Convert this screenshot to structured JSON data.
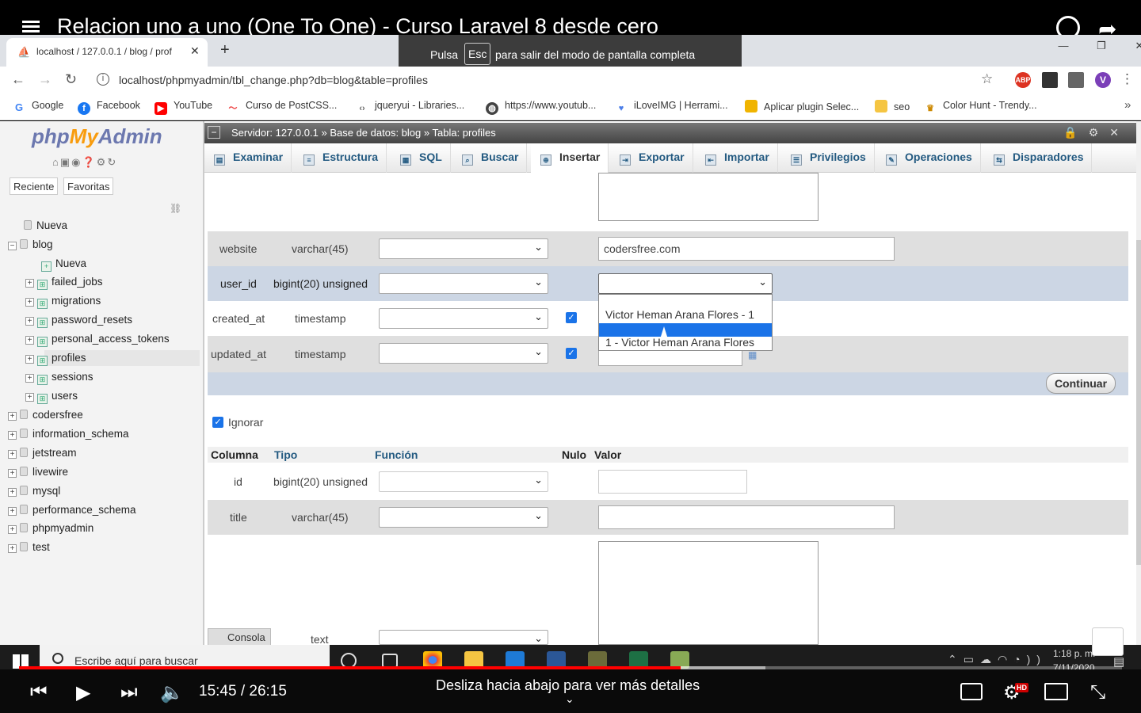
{
  "youtube": {
    "title": "Relacion uno a uno (One To One) - Curso Laravel 8 desde cero",
    "fullscreen_pre": "Pulsa",
    "fullscreen_key": "Esc",
    "fullscreen_post": "para salir del modo de pantalla completa",
    "time": "15:45 / 26:15",
    "swipe_hint": "Desliza hacia abajo para ver más detalles",
    "progress_fraction": 0.6,
    "buffer_fraction": 0.677,
    "hd_badge": "HD"
  },
  "browser": {
    "tab_title": "localhost / 127.0.0.1 / blog / prof",
    "url": "localhost/phpmyadmin/tbl_change.php?db=blog&table=profiles",
    "bookmarks": [
      "Google",
      "Facebook",
      "YouTube",
      "Curso de PostCSS...",
      "jqueryui - Libraries...",
      "https://www.youtub...",
      "iLoveIMG | Herrami...",
      "Aplicar plugin Selec...",
      "seo",
      "Color Hunt - Trendy..."
    ],
    "profile_initial": "V",
    "abp_label": "ABP"
  },
  "pma": {
    "logo_php": "php",
    "logo_my": "My",
    "logo_admin": "Admin",
    "recent": "Reciente",
    "favorites": "Favoritas",
    "tree": {
      "new": "Nueva",
      "blog": "blog",
      "blog_new": "Nueva",
      "tables": [
        "failed_jobs",
        "migrations",
        "password_resets",
        "personal_access_tokens",
        "profiles",
        "sessions",
        "users"
      ],
      "databases": [
        "codersfree",
        "information_schema",
        "jetstream",
        "livewire",
        "mysql",
        "performance_schema",
        "phpmyadmin",
        "test"
      ]
    },
    "breadcrumb": {
      "server": "Servidor: 127.0.0.1 »",
      "db": "Base de datos: blog »",
      "table": "Tabla: profiles"
    },
    "tabs": [
      "Examinar",
      "Estructura",
      "SQL",
      "Buscar",
      "Insertar",
      "Exportar",
      "Importar",
      "Privilegios",
      "Operaciones",
      "Disparadores"
    ],
    "rows": [
      {
        "name": "website",
        "type": "varchar(45)",
        "value": "codersfree.com"
      },
      {
        "name": "user_id",
        "type": "bigint(20) unsigned",
        "value": ""
      },
      {
        "name": "created_at",
        "type": "timestamp",
        "value": ""
      },
      {
        "name": "updated_at",
        "type": "timestamp",
        "value": ""
      }
    ],
    "dropdown_options": [
      "Victor Heman Arana Flores - 1",
      "1 - Victor Heman Arana Flores"
    ],
    "continue": "Continuar",
    "ignore": "Ignorar",
    "headers": {
      "col": "Columna",
      "type": "Tipo",
      "func": "Función",
      "null": "Nulo",
      "val": "Valor"
    },
    "rows2": [
      {
        "name": "id",
        "type": "bigint(20) unsigned"
      },
      {
        "name": "title",
        "type": "varchar(45)"
      },
      {
        "name": "",
        "type": "text"
      }
    ],
    "console": "Consola"
  },
  "taskbar": {
    "search": "Escribe aquí para buscar",
    "time": "1:18 p. m.",
    "date": "7/11/2020"
  }
}
